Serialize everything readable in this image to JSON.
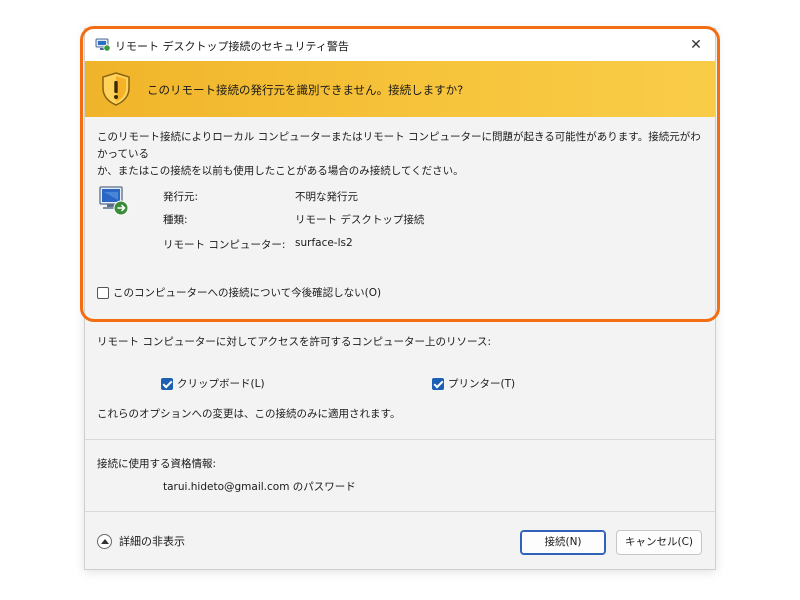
{
  "window": {
    "title": "リモート デスクトップ接続のセキュリティ警告",
    "close_glyph": "✕"
  },
  "warning": {
    "headline": "このリモート接続の発行元を識別できません。接続しますか?"
  },
  "description": {
    "line1": "このリモート接続によりローカル コンピューターまたはリモート コンピューターに問題が起きる可能性があります。接続元がわかってい",
    "line2": "る",
    "line3": "か、またはこの接続を以前も使用したことがある場合のみ接続してください。"
  },
  "info": {
    "publisher_label": "発行元:",
    "publisher_value": "不明な発行元",
    "type_label": "種類:",
    "type_value": "リモート デスクトップ接続",
    "remote_label": "リモート コンピューター:",
    "remote_value": "surface-ls2"
  },
  "dont_ask": {
    "label": "このコンピューターへの接続について今後確認しない(O)",
    "checked": false
  },
  "resources": {
    "heading": "リモート コンピューターに対してアクセスを許可するコンピューター上のリソース:",
    "clipboard_label": "クリップボード(L)",
    "clipboard_checked": true,
    "printer_label": "プリンター(T)",
    "printer_checked": true,
    "note": "これらのオプションへの変更は、この接続のみに適用されます。"
  },
  "credentials": {
    "heading": "接続に使用する資格情報:",
    "value": "tarui.hideto@gmail.com のパスワード"
  },
  "footer": {
    "details_label": "詳細の非表示",
    "connect_label": "接続(N)",
    "cancel_label": "キャンセル(C)"
  },
  "colors": {
    "banner": "#f7c53c",
    "highlight": "#f36d12",
    "accent": "#1c5fb3"
  }
}
